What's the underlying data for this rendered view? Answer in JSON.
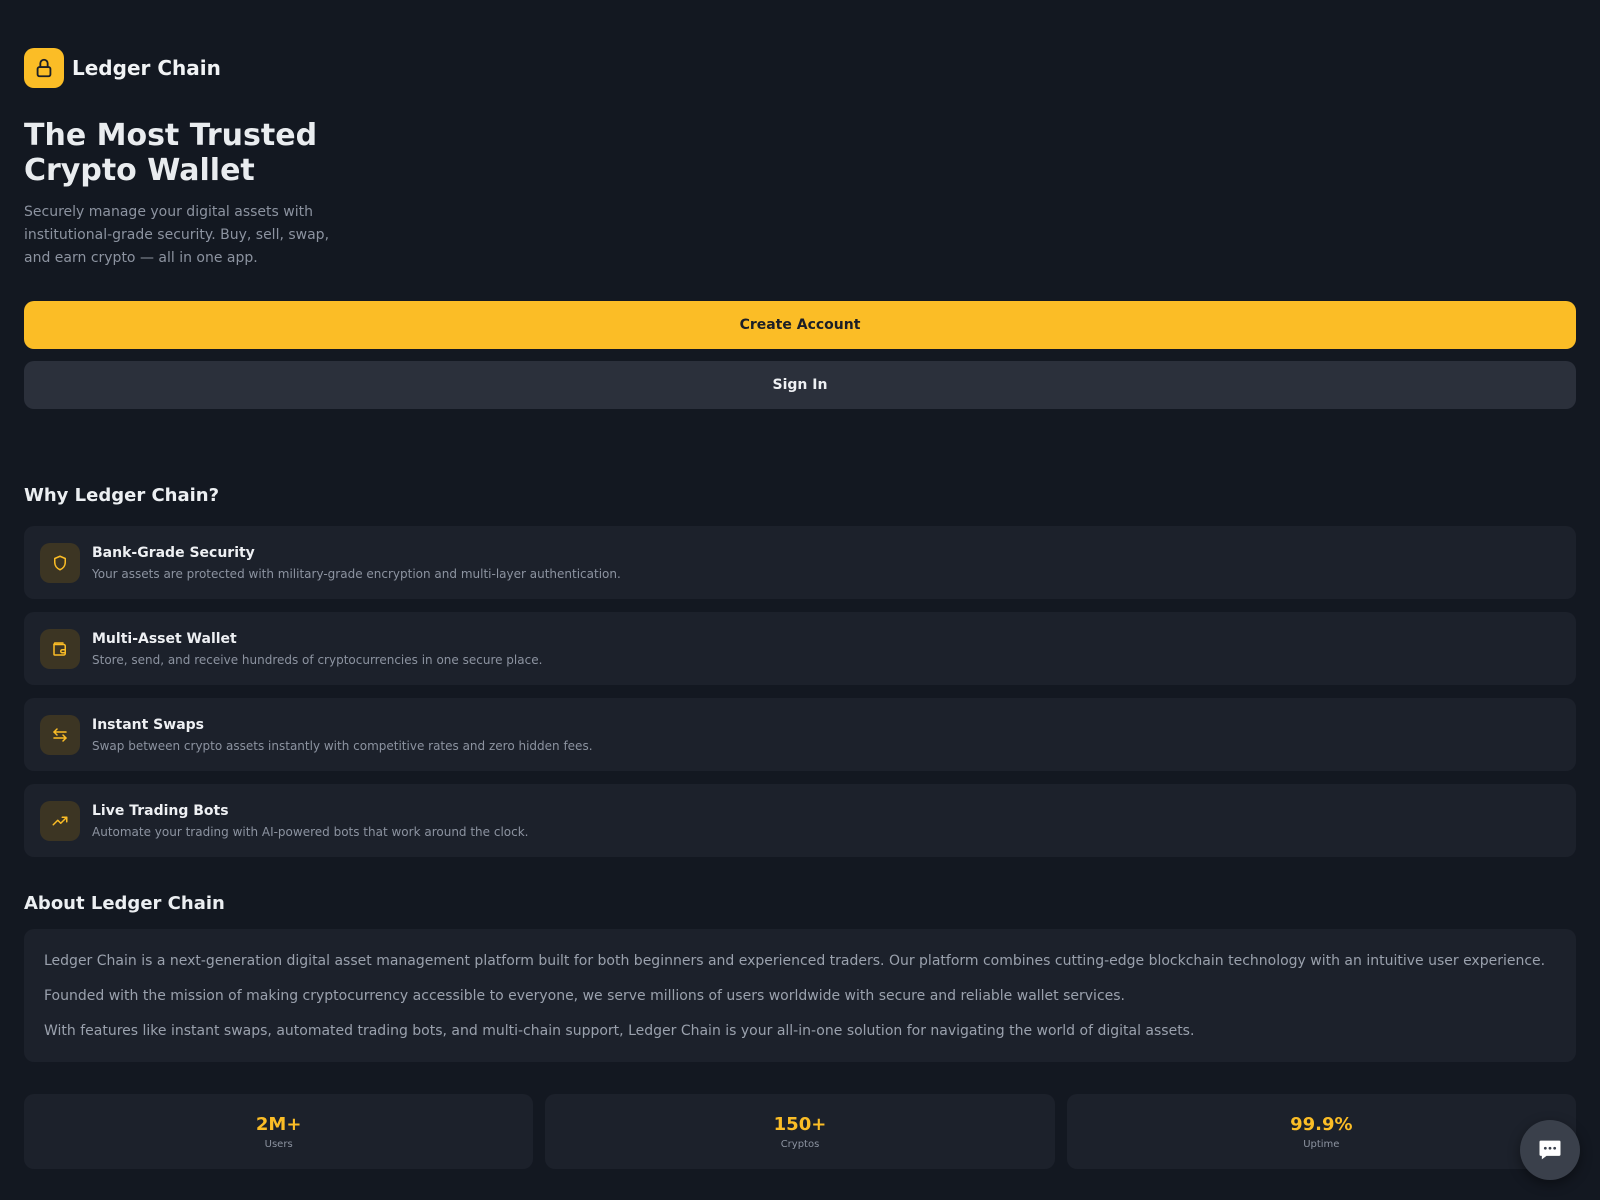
{
  "brand": {
    "name": "Ledger Chain",
    "logo_icon": "lock-icon",
    "accent": "#fbbd26"
  },
  "hero": {
    "title": "The Most Trusted Crypto Wallet",
    "subtitle": "Securely manage your digital assets with institutional-grade security. Buy, sell, swap, and earn crypto — all in one app."
  },
  "actions": {
    "create_account": "Create Account",
    "sign_in": "Sign In"
  },
  "why": {
    "title": "Why Ledger Chain?",
    "features": [
      {
        "icon": "shield-icon",
        "title": "Bank-Grade Security",
        "desc": "Your assets are protected with military-grade encryption and multi-layer authentication."
      },
      {
        "icon": "wallet-icon",
        "title": "Multi-Asset Wallet",
        "desc": "Store, send, and receive hundreds of cryptocurrencies in one secure place."
      },
      {
        "icon": "swap-icon",
        "title": "Instant Swaps",
        "desc": "Swap between crypto assets instantly with competitive rates and zero hidden fees."
      },
      {
        "icon": "trending-up-icon",
        "title": "Live Trading Bots",
        "desc": "Automate your trading with AI-powered bots that work around the clock."
      }
    ]
  },
  "about": {
    "title": "About Ledger Chain",
    "paragraphs": [
      "Ledger Chain is a next-generation digital asset management platform built for both beginners and experienced traders. Our platform combines cutting-edge blockchain technology with an intuitive user experience.",
      "Founded with the mission of making cryptocurrency accessible to everyone, we serve millions of users worldwide with secure and reliable wallet services.",
      "With features like instant swaps, automated trading bots, and multi-chain support, Ledger Chain is your all-in-one solution for navigating the world of digital assets."
    ]
  },
  "stats": [
    {
      "value": "2M+",
      "label": "Users"
    },
    {
      "value": "150+",
      "label": "Cryptos"
    },
    {
      "value": "99.9%",
      "label": "Uptime"
    }
  ],
  "chat": {
    "icon": "chat-icon"
  }
}
